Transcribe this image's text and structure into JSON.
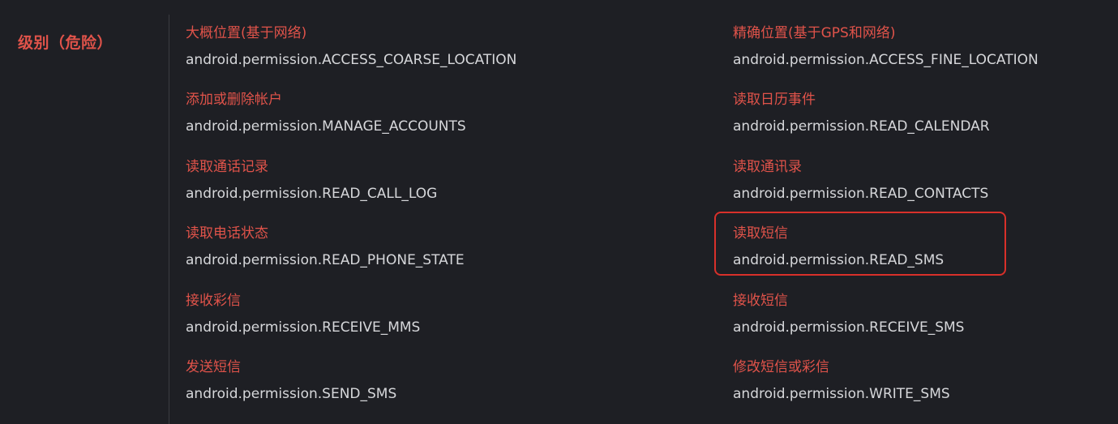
{
  "level": {
    "label": "级别（危险）"
  },
  "permissions": [
    {
      "cn": "大概位置(基于网络)",
      "en": "android.permission.ACCESS_COARSE_LOCATION"
    },
    {
      "cn": "精确位置(基于GPS和网络)",
      "en": "android.permission.ACCESS_FINE_LOCATION"
    },
    {
      "cn": "添加或删除帐户",
      "en": "android.permission.MANAGE_ACCOUNTS"
    },
    {
      "cn": "读取日历事件",
      "en": "android.permission.READ_CALENDAR"
    },
    {
      "cn": "读取通话记录",
      "en": "android.permission.READ_CALL_LOG"
    },
    {
      "cn": "读取通讯录",
      "en": "android.permission.READ_CONTACTS"
    },
    {
      "cn": "读取电话状态",
      "en": "android.permission.READ_PHONE_STATE"
    },
    {
      "cn": "读取短信",
      "en": "android.permission.READ_SMS"
    },
    {
      "cn": "接收彩信",
      "en": "android.permission.RECEIVE_MMS"
    },
    {
      "cn": "接收短信",
      "en": "android.permission.RECEIVE_SMS"
    },
    {
      "cn": "发送短信",
      "en": "android.permission.SEND_SMS"
    },
    {
      "cn": "修改短信或彩信",
      "en": "android.permission.WRITE_SMS"
    }
  ],
  "colors": {
    "background": "#1e1f24",
    "accent": "#e0534a",
    "text": "#d6d7da",
    "highlight_border": "#d8302a"
  }
}
